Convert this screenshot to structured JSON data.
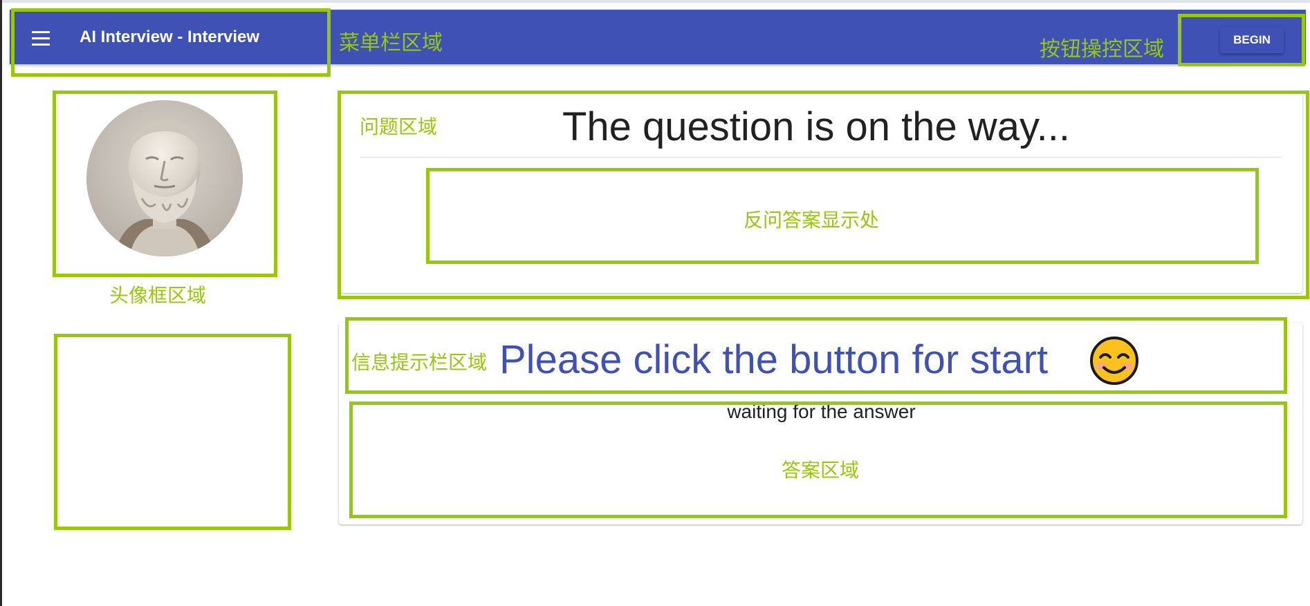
{
  "app": {
    "title": "AI Interview - Interview",
    "begin_label": "BEGIN"
  },
  "question": {
    "text": "The question is on the way..."
  },
  "info": {
    "prompt": "Please click the button for start"
  },
  "answer": {
    "status": "waiting for the answer"
  },
  "annotations": {
    "menu_bar": "菜单栏区域",
    "button_area": "按钮操控区域",
    "question_area": "问题区域",
    "counter_answer": "反问答案显示处",
    "avatar_area": "头像框区域",
    "info_bar": "信息提示栏区域",
    "answer_area": "答案区域"
  },
  "colors": {
    "primary": "#3f51b5",
    "annotation": "#97c80a",
    "text_dark": "#212121"
  },
  "icons": {
    "menu": "menu-icon",
    "smiley": "smiley-emoji-icon",
    "avatar": "aristotle-bust-avatar"
  }
}
